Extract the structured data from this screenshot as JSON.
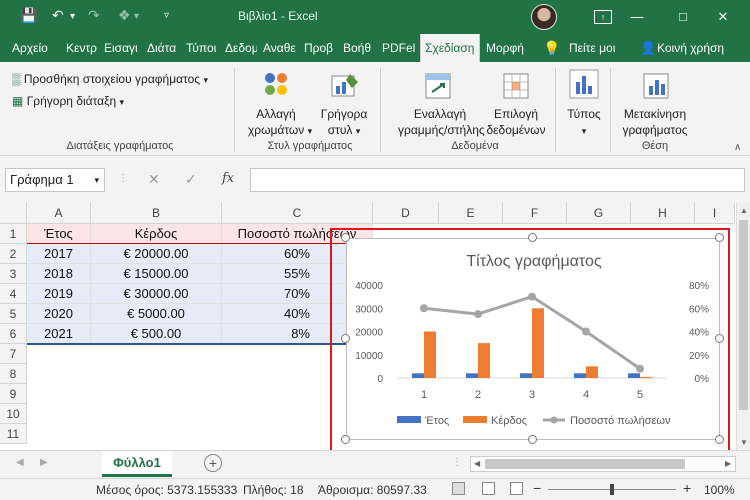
{
  "titlebar": {
    "save_icon": "save-icon",
    "title": "Βιβλίο1 - Excel",
    "brand_color": "#217346"
  },
  "tabs": [
    "Αρχείο",
    "Κεντρ",
    "Εισαγι",
    "Διάτα",
    "Τύποι",
    "Δεδομ",
    "Αναθε",
    "Προβ",
    "Βοήθ",
    "PDFel",
    "Σχεδίαση",
    "Μορφή",
    "Πείτε μοι",
    "Κοινή χρήση"
  ],
  "ribbon": {
    "add_element": "Προσθήκη στοιχείου γραφήματος",
    "quick_layout": "Γρήγορη διάταξη",
    "group_layouts": "Διατάξεις γραφήματος",
    "change_colors_1": "Αλλαγή",
    "change_colors_2": "χρωμάτων",
    "quick_style_1": "Γρήγορα",
    "quick_style_2": "στυλ",
    "group_styles": "Στυλ γραφήματος",
    "switch_rowcol_1": "Εναλλαγή",
    "switch_rowcol_2": "γραμμής/στήλης",
    "select_data_1": "Επιλογή",
    "select_data_2": "δεδομένων",
    "group_data": "Δεδομένα",
    "type_label": "Τύπος",
    "move_chart_1": "Μετακίνηση",
    "move_chart_2": "γραφήματος",
    "group_location": "Θέση"
  },
  "formula": {
    "namebox": "Γράφημα 1",
    "fx": "fx",
    "value": ""
  },
  "grid": {
    "columns": [
      "A",
      "B",
      "C",
      "D",
      "E",
      "F",
      "G",
      "H",
      "I"
    ],
    "rows": [
      "1",
      "2",
      "3",
      "4",
      "5",
      "6",
      "7",
      "8",
      "9",
      "10",
      "11"
    ],
    "header": [
      "Έτος",
      "Κέρδος",
      "Ποσοστό πωλήσεων"
    ],
    "data": [
      [
        "2017",
        "€ 20000.00",
        "60%"
      ],
      [
        "2018",
        "€ 15000.00",
        "55%"
      ],
      [
        "2019",
        "€ 30000.00",
        "70%"
      ],
      [
        "2020",
        "€ 5000.00",
        "40%"
      ],
      [
        "2021",
        "€ 500.00",
        "8%"
      ]
    ]
  },
  "chart_data": {
    "type": "bar",
    "title": "Τίτλος γραφήματος",
    "categories": [
      "1",
      "2",
      "3",
      "4",
      "5"
    ],
    "series": [
      {
        "name": "Έτος",
        "type": "bar",
        "axis": "left",
        "color": "#4472c4",
        "values": [
          2017,
          2018,
          2019,
          2020,
          2021
        ]
      },
      {
        "name": "Κέρδος",
        "type": "bar",
        "axis": "left",
        "color": "#ed7d31",
        "values": [
          20000,
          15000,
          30000,
          5000,
          500
        ]
      },
      {
        "name": "Ποσοστό πωλήσεων",
        "type": "line",
        "axis": "right",
        "color": "#a5a5a5",
        "values": [
          0.6,
          0.55,
          0.7,
          0.4,
          0.08
        ]
      }
    ],
    "y_ticks": [
      "40000",
      "30000",
      "20000",
      "10000",
      "0"
    ],
    "y2_ticks": [
      "80%",
      "60%",
      "40%",
      "20%",
      "0%"
    ],
    "ylim": [
      0,
      40000
    ],
    "y2lim": [
      0,
      0.8
    ],
    "legend": "bottom",
    "grid": false
  },
  "sheet": {
    "name": "Φύλλο1",
    "add_icon": "plus-icon"
  },
  "status": {
    "average": "Μέσος όρος: 5373.155333",
    "count": "Πλήθος: 18",
    "sum": "Άθροισμα: 80597.33",
    "zoom": "100%"
  }
}
